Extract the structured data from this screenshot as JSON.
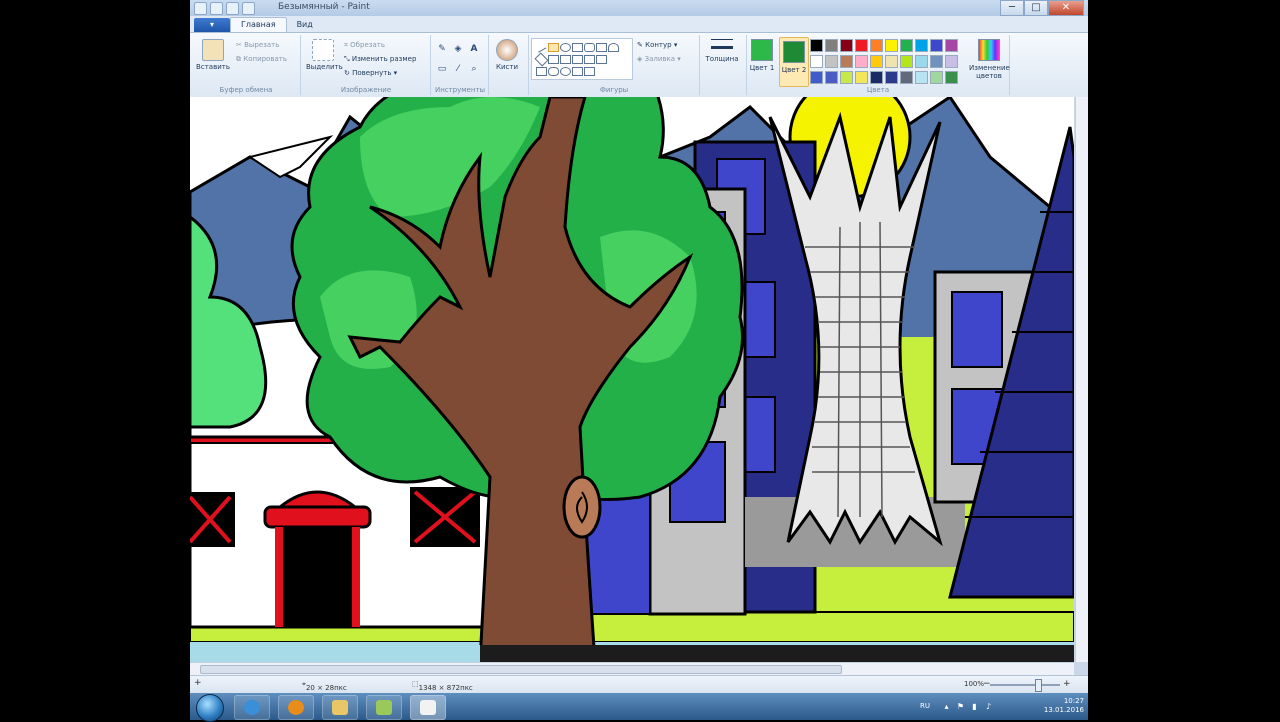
{
  "window": {
    "title": "Безымянный - Paint",
    "controls": {
      "minimize": "─",
      "maximize": "□",
      "close": "✕"
    }
  },
  "tabs": {
    "file": "▾",
    "home": "Главная",
    "view": "Вид"
  },
  "ribbon": {
    "clipboard": {
      "label": "Буфер обмена",
      "paste": "Вставить",
      "cut": "Вырезать",
      "copy": "Копировать"
    },
    "image": {
      "label": "Изображение",
      "select": "Выделить",
      "crop": "Обрезать",
      "resize": "Изменить размер",
      "rotate": "Повернуть"
    },
    "tools": {
      "label": "Инструменты"
    },
    "brushes": "Кисти",
    "shapes": {
      "label": "Фигуры",
      "outline": "Контур",
      "fill": "Заливка"
    },
    "size": "Толщина",
    "colors": {
      "label": "Цвета",
      "color1": "Цвет 1",
      "color2": "Цвет 2",
      "edit": "Изменение цветов",
      "color1_value": "#2fb84a",
      "color2_value": "#1f8a36",
      "palette": [
        "#000000",
        "#7f7f7f",
        "#880015",
        "#ed1c24",
        "#ff7f27",
        "#fff200",
        "#22b14c",
        "#00a2e8",
        "#3f48cc",
        "#a349a4",
        "#ffffff",
        "#c3c3c3",
        "#b97a57",
        "#ffaec9",
        "#ffc90e",
        "#efe4b0",
        "#b5e61d",
        "#99d9ea",
        "#7092be",
        "#c8bfe7",
        "#3f5bcc",
        "#4a5cc4",
        "#c6e84d",
        "#f2e75c",
        "#1c2a63",
        "#2b3a8a",
        "#606a7a",
        "#b8e3f2",
        "#9fd7a0",
        "#3a8f4b"
      ]
    }
  },
  "status": {
    "cursor": "20 × 28пкс",
    "canvas_size": "1348 × 872пкс",
    "zoom": "100%"
  },
  "taskbar": {
    "lang": "RU",
    "time": "10:27",
    "date": "13.01.2016"
  }
}
